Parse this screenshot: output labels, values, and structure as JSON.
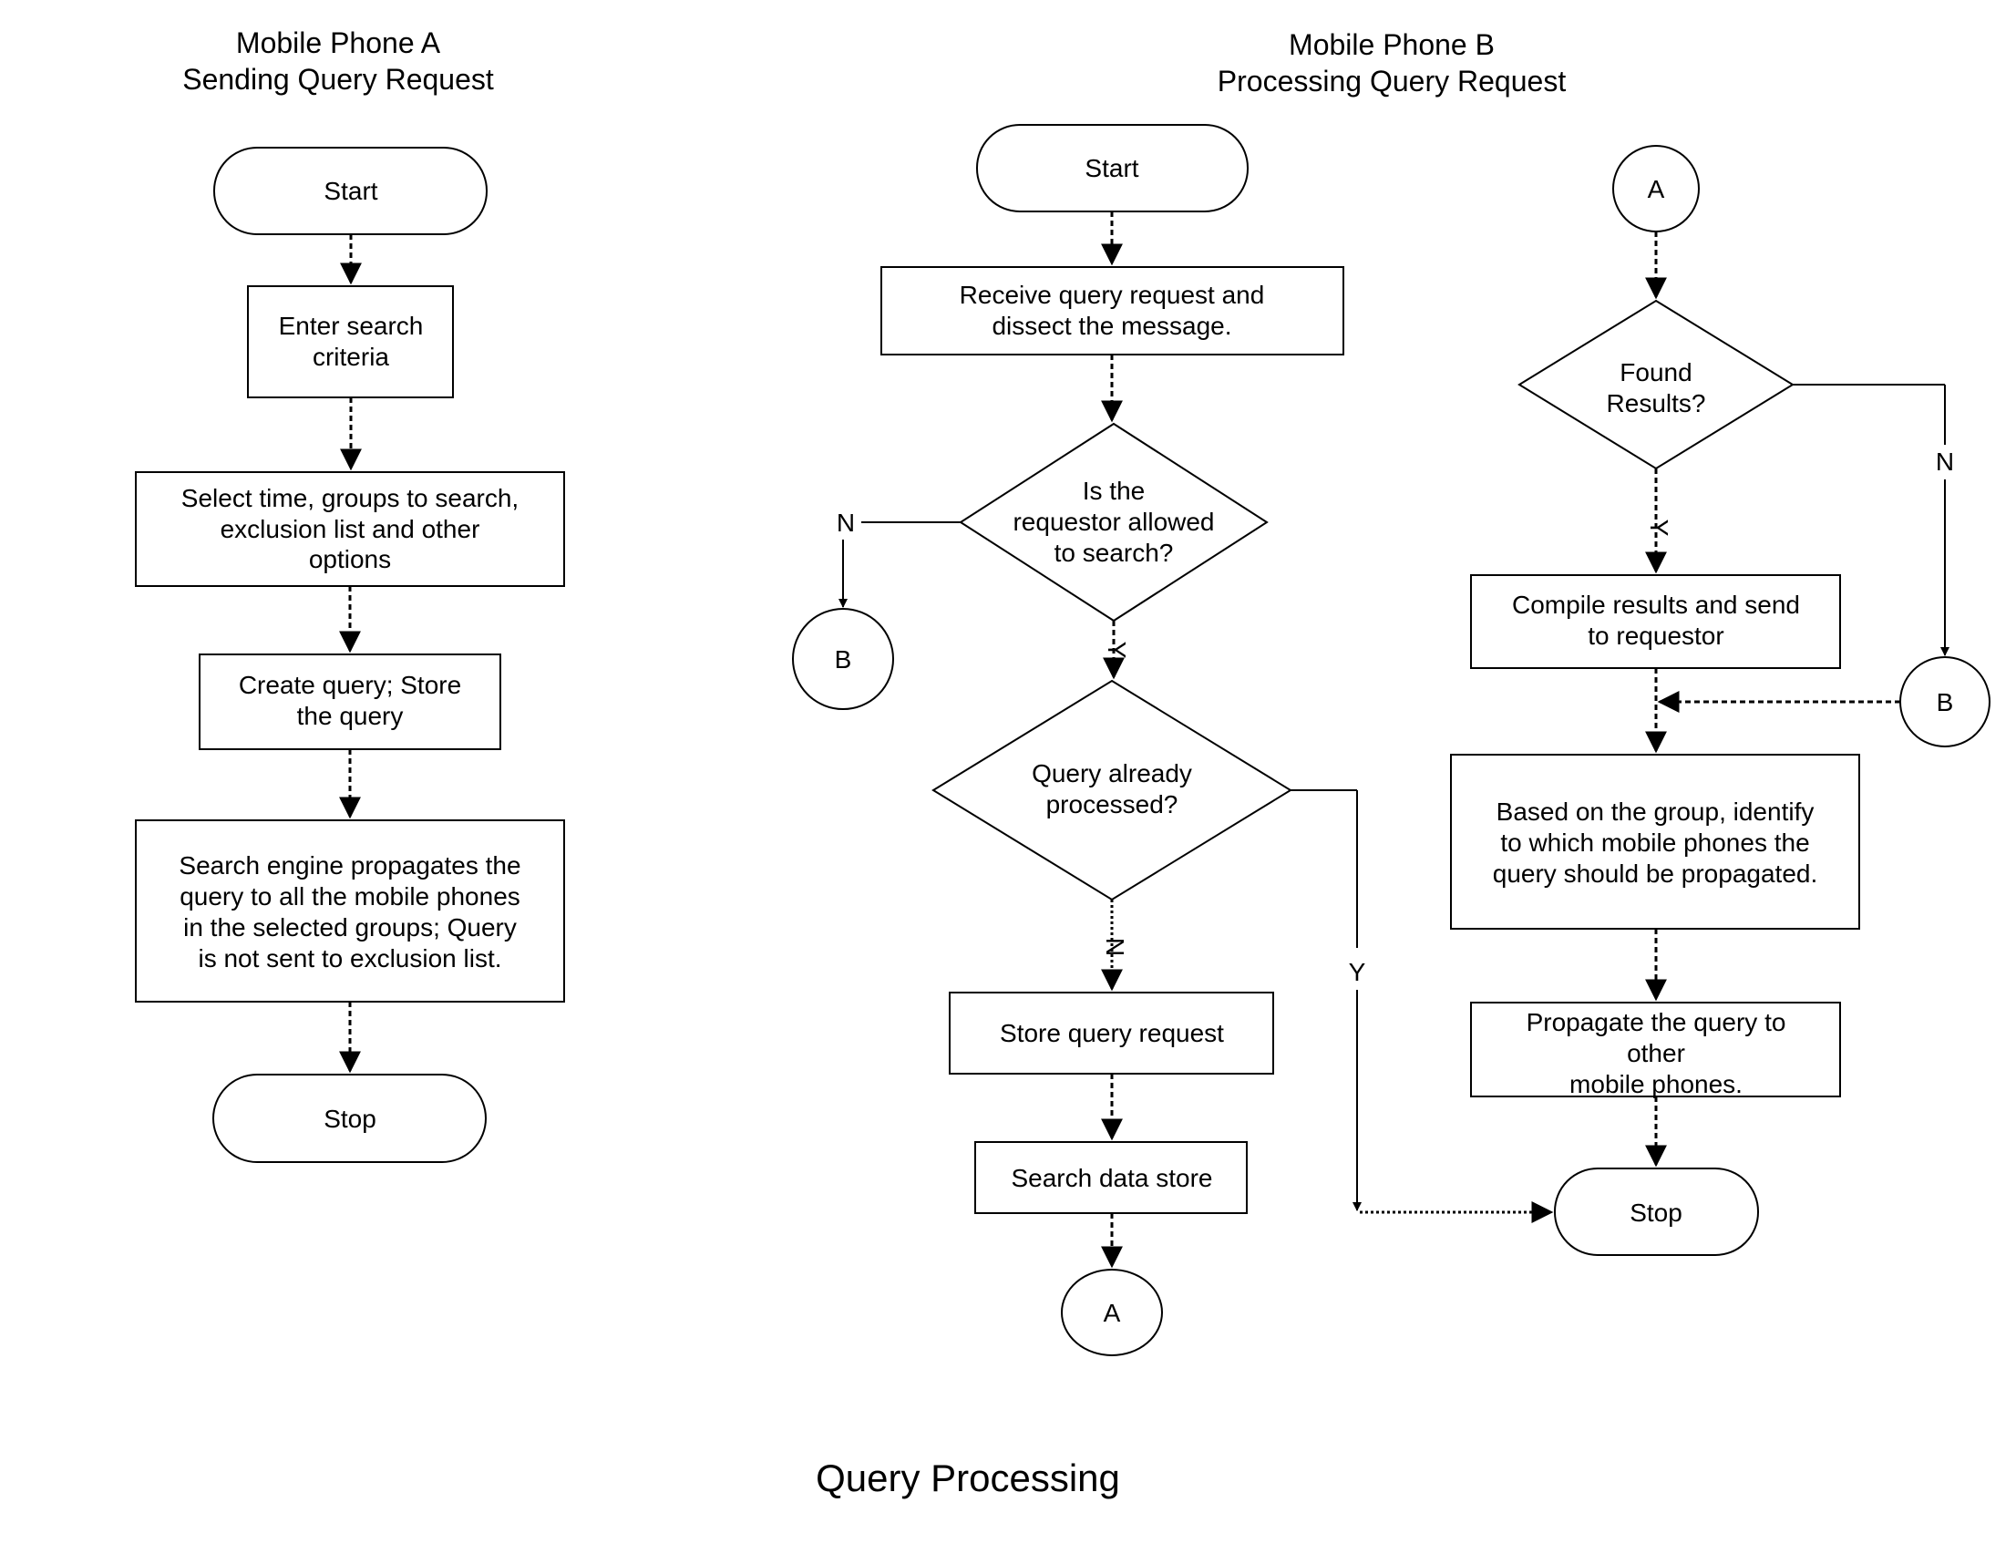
{
  "caption": "Query Processing",
  "phone_a": {
    "title_line1": "Mobile Phone A",
    "title_line2": "Sending Query Request",
    "start": "Start",
    "enter_criteria": [
      "Enter search",
      "criteria"
    ],
    "select_options": [
      "Select time, groups to search,",
      "exclusion list and other",
      "options"
    ],
    "create_query": [
      "Create query; Store",
      "the query"
    ],
    "propagate": [
      "Search engine propagates the",
      "query to all the mobile phones",
      "in the selected groups; Query",
      "is not sent to exclusion list."
    ],
    "stop": "Stop"
  },
  "phone_b": {
    "title_line1": "Mobile Phone B",
    "title_line2": "Processing Query Request",
    "start": "Start",
    "receive": [
      "Receive query request and",
      "dissect the message."
    ],
    "allowed_decision": [
      "Is the",
      "requestor allowed",
      "to search?"
    ],
    "allowed_no_label": "N",
    "allowed_yes_label": "Y",
    "connector_b": "B",
    "processed_decision": [
      "Query already",
      "processed?"
    ],
    "processed_no_label": "N",
    "processed_yes_label": "Y",
    "store_request": "Store query request",
    "search_store": "Search data store",
    "connector_a": "A",
    "found_decision": [
      "Found",
      "Results?"
    ],
    "found_no_label": "N",
    "found_yes_label": "Y",
    "compile": [
      "Compile results and send",
      "to requestor"
    ],
    "identify": [
      "Based on the group, identify",
      "to which mobile phones the",
      "query should be propagated."
    ],
    "propagate": [
      "Propagate the query to",
      "other",
      "mobile phones."
    ],
    "stop": "Stop"
  }
}
